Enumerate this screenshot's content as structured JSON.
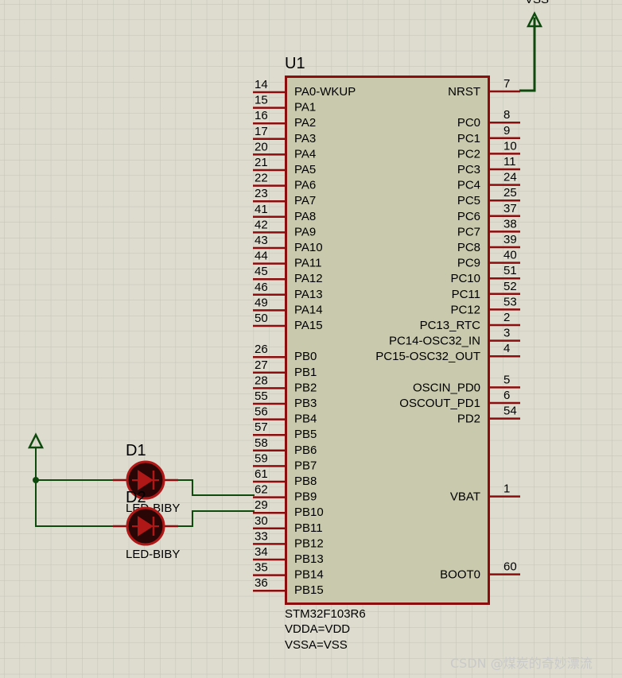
{
  "colors": {
    "background": "#dddccf",
    "grid": "#c4c3b6",
    "chip_fill": "#c9c9ad",
    "chip_border": "#8b0d0d",
    "pin": "#8b0d0d",
    "wire": "#0e4a0e",
    "led_body": "#2a0606",
    "led_ring": "#b01818",
    "watermark": "#c9c9c9"
  },
  "chip": {
    "ref": "U1",
    "part": "STM32F103R6",
    "notes": [
      "VDDA=VDD",
      "VSSA=VSS"
    ],
    "left_pins": [
      {
        "num": "14",
        "name": "PA0-WKUP"
      },
      {
        "num": "15",
        "name": "PA1"
      },
      {
        "num": "16",
        "name": "PA2"
      },
      {
        "num": "17",
        "name": "PA3"
      },
      {
        "num": "20",
        "name": "PA4"
      },
      {
        "num": "21",
        "name": "PA5"
      },
      {
        "num": "22",
        "name": "PA6"
      },
      {
        "num": "23",
        "name": "PA7"
      },
      {
        "num": "41",
        "name": "PA8"
      },
      {
        "num": "42",
        "name": "PA9"
      },
      {
        "num": "43",
        "name": "PA10"
      },
      {
        "num": "44",
        "name": "PA11"
      },
      {
        "num": "45",
        "name": "PA12"
      },
      {
        "num": "46",
        "name": "PA13"
      },
      {
        "num": "49",
        "name": "PA14"
      },
      {
        "num": "50",
        "name": "PA15"
      },
      null,
      {
        "num": "26",
        "name": "PB0"
      },
      {
        "num": "27",
        "name": "PB1"
      },
      {
        "num": "28",
        "name": "PB2"
      },
      {
        "num": "55",
        "name": "PB3"
      },
      {
        "num": "56",
        "name": "PB4"
      },
      {
        "num": "57",
        "name": "PB5"
      },
      {
        "num": "58",
        "name": "PB6"
      },
      {
        "num": "59",
        "name": "PB7"
      },
      {
        "num": "61",
        "name": "PB8"
      },
      {
        "num": "62",
        "name": "PB9"
      },
      {
        "num": "29",
        "name": "PB10"
      },
      {
        "num": "30",
        "name": "PB11"
      },
      {
        "num": "33",
        "name": "PB12"
      },
      {
        "num": "34",
        "name": "PB13"
      },
      {
        "num": "35",
        "name": "PB14"
      },
      {
        "num": "36",
        "name": "PB15"
      }
    ],
    "right_pins": [
      {
        "num": "7",
        "name": "NRST"
      },
      null,
      {
        "num": "8",
        "name": "PC0"
      },
      {
        "num": "9",
        "name": "PC1"
      },
      {
        "num": "10",
        "name": "PC2"
      },
      {
        "num": "11",
        "name": "PC3"
      },
      {
        "num": "24",
        "name": "PC4"
      },
      {
        "num": "25",
        "name": "PC5"
      },
      {
        "num": "37",
        "name": "PC6"
      },
      {
        "num": "38",
        "name": "PC7"
      },
      {
        "num": "39",
        "name": "PC8"
      },
      {
        "num": "40",
        "name": "PC9"
      },
      {
        "num": "51",
        "name": "PC10"
      },
      {
        "num": "52",
        "name": "PC11"
      },
      {
        "num": "53",
        "name": "PC12"
      },
      {
        "num": "2",
        "name": "PC13_RTC"
      },
      {
        "num": "3",
        "name": "PC14-OSC32_IN"
      },
      {
        "num": "4",
        "name": "PC15-OSC32_OUT"
      },
      null,
      {
        "num": "5",
        "name": "OSCIN_PD0"
      },
      {
        "num": "6",
        "name": "OSCOUT_PD1"
      },
      {
        "num": "54",
        "name": "PD2"
      },
      null,
      null,
      null,
      null,
      {
        "num": "1",
        "name": "VBAT"
      },
      null,
      null,
      null,
      null,
      {
        "num": "60",
        "name": "BOOT0"
      }
    ]
  },
  "top_power_label": "VSS",
  "leds": [
    {
      "ref": "D1",
      "value": "LED-BIBY"
    },
    {
      "ref": "D2",
      "value": "LED-BIBY"
    }
  ],
  "watermark": "CSDN @煤炭的奇妙漂流"
}
